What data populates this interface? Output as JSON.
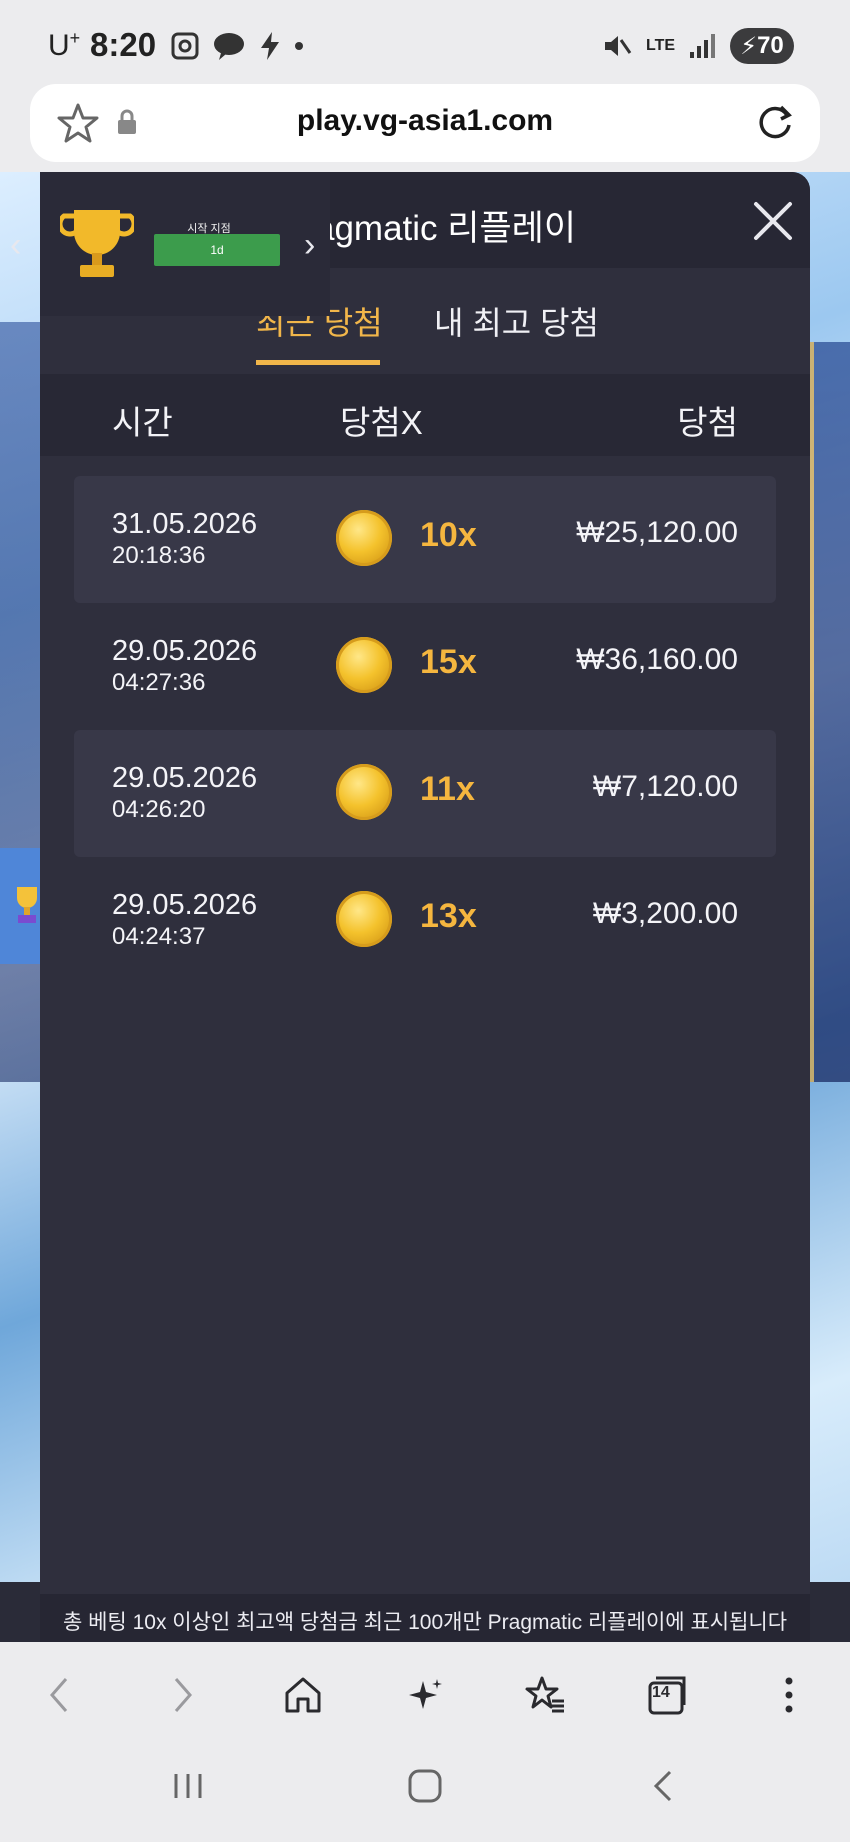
{
  "status_bar": {
    "carrier": "U",
    "carrier_sup": "+",
    "time": "8:20",
    "battery": "70",
    "network": "LTE"
  },
  "url_bar": {
    "url": "play.vg-asia1.com"
  },
  "trophy_widget": {
    "label": "시작 지점",
    "badge": "1d"
  },
  "modal": {
    "title": "Pragmatic 리플레이",
    "tabs": [
      {
        "label": "최근 당첨",
        "active": true
      },
      {
        "label": "내 최고 당첨",
        "active": false
      }
    ],
    "columns": {
      "time": "시간",
      "multiplier": "당첨X",
      "win": "당첨"
    },
    "rows": [
      {
        "date": "31.05.2026",
        "time": "20:18:36",
        "multiplier": "10x",
        "amount": "₩25,120.00"
      },
      {
        "date": "29.05.2026",
        "time": "04:27:36",
        "multiplier": "15x",
        "amount": "₩36,160.00"
      },
      {
        "date": "29.05.2026",
        "time": "04:26:20",
        "multiplier": "11x",
        "amount": "₩7,120.00"
      },
      {
        "date": "29.05.2026",
        "time": "04:24:37",
        "multiplier": "13x",
        "amount": "₩3,200.00"
      }
    ],
    "footer_note": "총 베팅 10x 이상인 최고액 당첨금 최근 100개만 Pragmatic 리플레이에 표시됩니다"
  },
  "browser_nav": {
    "tab_count": "14"
  },
  "colors": {
    "accent": "#f1b64a",
    "modal_bg": "#2f2f3d",
    "badge_green": "#3c9c4c"
  }
}
